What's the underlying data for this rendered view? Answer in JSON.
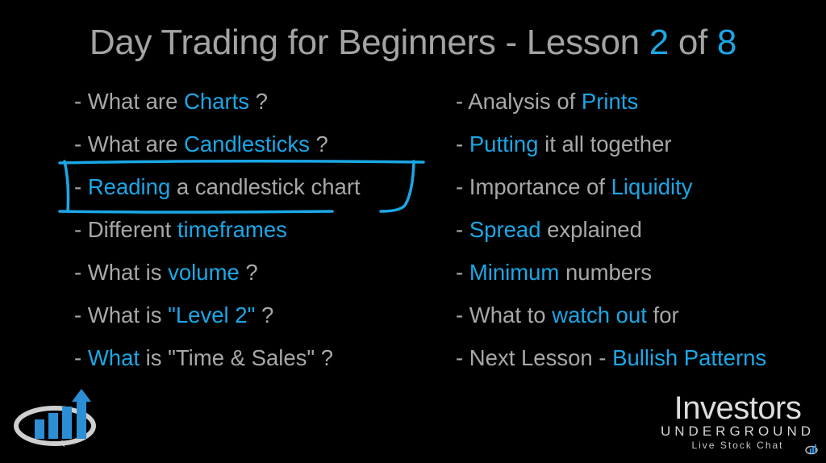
{
  "title": {
    "prefix": "Day Trading for Beginners - Lesson ",
    "lesson_number": "2",
    "middle": " of ",
    "total_lessons": "8"
  },
  "colors": {
    "accent": "#1ba7e6",
    "text": "#a8a8a8",
    "background": "#000000"
  },
  "left_column": [
    {
      "parts": [
        {
          "t": "- What are ",
          "hl": false
        },
        {
          "t": "Charts",
          "hl": true
        },
        {
          "t": " ?",
          "hl": false
        }
      ]
    },
    {
      "parts": [
        {
          "t": "- What are ",
          "hl": false
        },
        {
          "t": "Candlesticks",
          "hl": true
        },
        {
          "t": " ?",
          "hl": false
        }
      ]
    },
    {
      "parts": [
        {
          "t": "- ",
          "hl": false
        },
        {
          "t": "Reading",
          "hl": true
        },
        {
          "t": " a candlestick chart",
          "hl": false
        }
      ],
      "circled": true
    },
    {
      "parts": [
        {
          "t": "- Different ",
          "hl": false
        },
        {
          "t": "timeframes",
          "hl": true
        }
      ]
    },
    {
      "parts": [
        {
          "t": "- What is ",
          "hl": false
        },
        {
          "t": "volume",
          "hl": true
        },
        {
          "t": " ?",
          "hl": false
        }
      ]
    },
    {
      "parts": [
        {
          "t": "- What is ",
          "hl": false
        },
        {
          "t": "\"Level 2\"",
          "hl": true
        },
        {
          "t": " ?",
          "hl": false
        }
      ]
    },
    {
      "parts": [
        {
          "t": "- ",
          "hl": false
        },
        {
          "t": "What",
          "hl": true
        },
        {
          "t": " is \"Time & Sales\" ?",
          "hl": false
        }
      ]
    }
  ],
  "right_column": [
    {
      "parts": [
        {
          "t": "- Analysis of ",
          "hl": false
        },
        {
          "t": "Prints",
          "hl": true
        }
      ]
    },
    {
      "parts": [
        {
          "t": "- ",
          "hl": false
        },
        {
          "t": "Putting",
          "hl": true
        },
        {
          "t": " it all together",
          "hl": false
        }
      ]
    },
    {
      "parts": [
        {
          "t": "- Importance of ",
          "hl": false
        },
        {
          "t": "Liquidity",
          "hl": true
        }
      ]
    },
    {
      "parts": [
        {
          "t": "- ",
          "hl": false
        },
        {
          "t": "Spread",
          "hl": true
        },
        {
          "t": " explained",
          "hl": false
        }
      ]
    },
    {
      "parts": [
        {
          "t": "- ",
          "hl": false
        },
        {
          "t": "Minimum",
          "hl": true
        },
        {
          "t": " numbers",
          "hl": false
        }
      ]
    },
    {
      "parts": [
        {
          "t": "- What to ",
          "hl": false
        },
        {
          "t": "watch out",
          "hl": true
        },
        {
          "t": " for",
          "hl": false
        }
      ]
    },
    {
      "parts": [
        {
          "t": "- Next Lesson - ",
          "hl": false
        },
        {
          "t": "Bullish Patterns",
          "hl": true
        }
      ]
    }
  ],
  "brand": {
    "name": "Investors",
    "sub": "UNDERGROUND",
    "tagline": "Live Stock Chat",
    "logo_icon": "chart-bubble-logo-icon"
  }
}
